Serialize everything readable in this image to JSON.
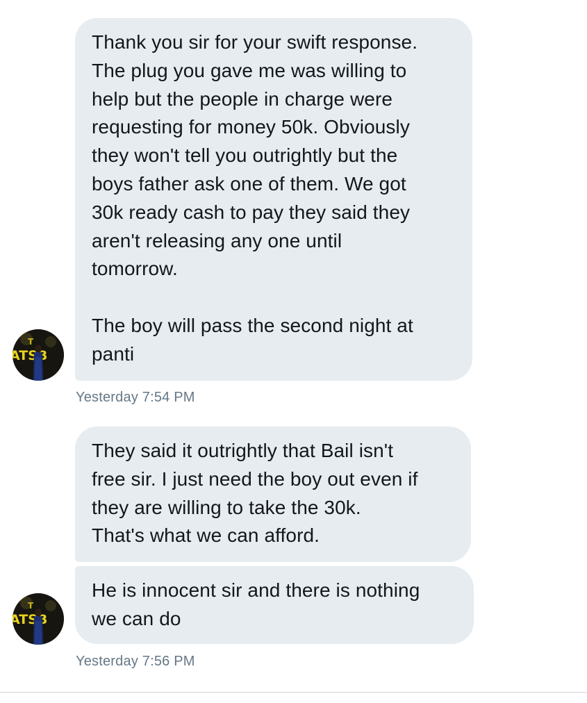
{
  "conversation": {
    "messages": [
      {
        "text": "Thank you sir for your swift response.\nThe plug you gave me was willing to\nhelp but the people in charge were\nrequesting for money 50k. Obviously\nthey won't tell you outrightly but the\nboys father ask one of them. We got\n30k ready cash to pay they said they\naren't releasing any one until\ntomorrow.\n\nThe boy will pass the second night at\npanti"
      },
      {
        "text": "They said it outrightly that Bail isn't\nfree sir. I just need the boy out even if\nthey are willing to take the 30k.\nThat's what we can afford."
      },
      {
        "text": "He is innocent sir and there is nothing\nwe can do"
      }
    ],
    "timestamps": [
      "Yesterday 7:54 PM",
      "Yesterday 7:56 PM"
    ],
    "avatar": {
      "icon": "profile-photo-icon",
      "accent_color": "#e8d21a"
    }
  },
  "theme": {
    "bubble_color": "#e6ecf0",
    "text_color": "#14171a",
    "timestamp_color": "#657786"
  }
}
